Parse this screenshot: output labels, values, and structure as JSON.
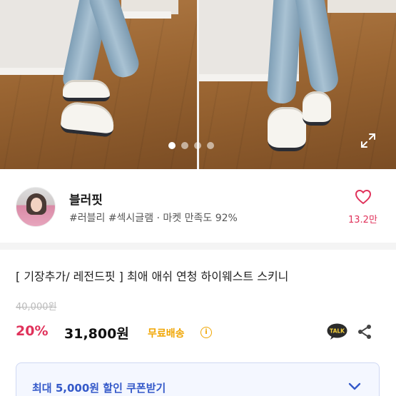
{
  "gallery": {
    "slide_count": 4,
    "active_slide": 1,
    "expand_icon": "expand-icon"
  },
  "seller": {
    "name": "블러핏",
    "tags": "#러블리 #섹시글램 · 마켓 만족도 92%",
    "likes": "13.2만",
    "like_icon": "heart-icon"
  },
  "product": {
    "title": "[ 기장추가/ 레전드핏 ] 최애 애쉬 연청 하이웨스트 스키니",
    "original_price": "40,000원",
    "discount": "20%",
    "price": "31,800원",
    "shipping": "무료배송",
    "talk_label": "TALK"
  },
  "coupon": {
    "label": "최대 5,000원 할인 쿠폰받기"
  },
  "colors": {
    "accent_pink": "#e0325b",
    "shipping_orange": "#f0a500",
    "coupon_blue": "#3459c9"
  }
}
